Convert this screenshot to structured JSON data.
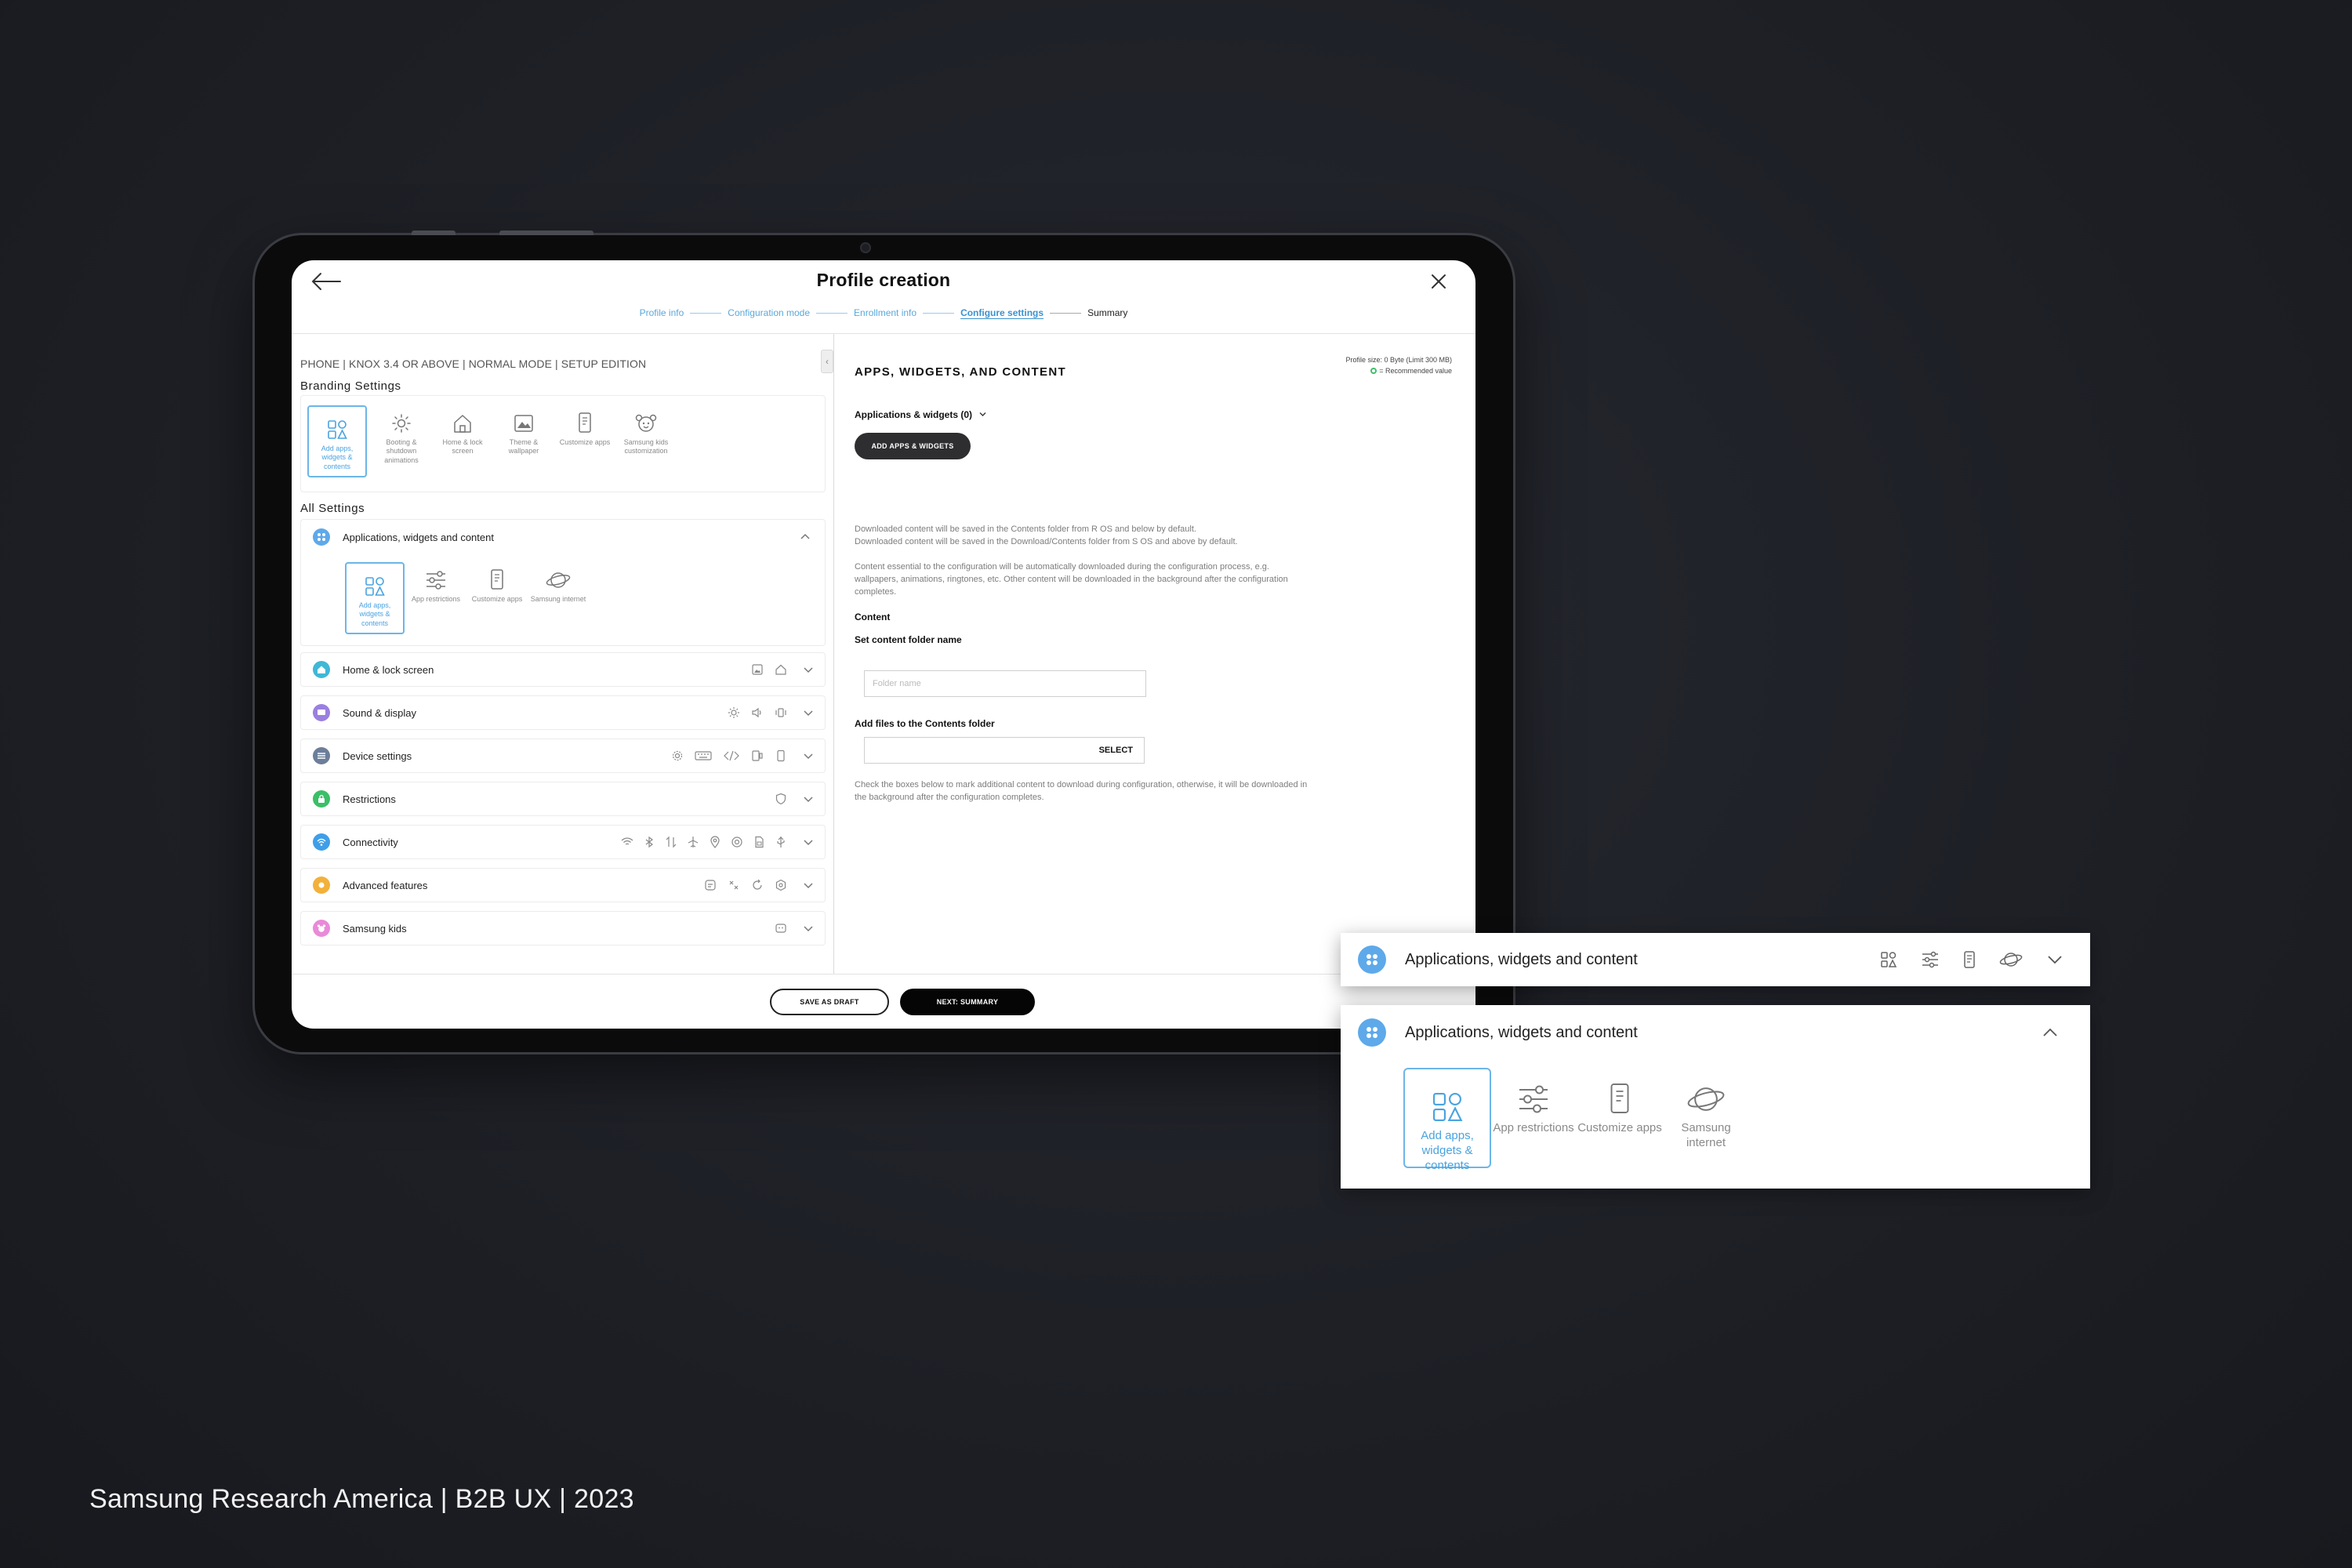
{
  "page": {
    "title": "Profile creation",
    "credit": "Samsung Research America | B2B UX | 2023"
  },
  "stepper": [
    {
      "label": "Profile info",
      "state": "done"
    },
    {
      "label": "Configuration mode",
      "state": "done"
    },
    {
      "label": "Enrollment info",
      "state": "done"
    },
    {
      "label": "Configure settings",
      "state": "active"
    },
    {
      "label": "Summary",
      "state": "todo"
    }
  ],
  "left": {
    "breadcrumb": "PHONE | KNOX 3.4 OR ABOVE | NORMAL MODE | SETUP EDITION",
    "branding_title": "Branding Settings",
    "branding_tiles": [
      {
        "label": "Add apps, widgets & contents",
        "icon": "apps-widgets-icon",
        "selected": true
      },
      {
        "label": "Booting & shutdown animations",
        "icon": "sun-icon",
        "selected": false
      },
      {
        "label": "Home & lock screen",
        "icon": "home-icon",
        "selected": false
      },
      {
        "label": "Theme & wallpaper",
        "icon": "image-icon",
        "selected": false
      },
      {
        "label": "Customize apps",
        "icon": "phone-icon",
        "selected": false
      },
      {
        "label": "Samsung kids customization",
        "icon": "kids-icon",
        "selected": false
      }
    ],
    "all_title": "All Settings",
    "expanded": {
      "label": "Applications, widgets and content",
      "tiles": [
        {
          "label": "Add apps, widgets & contents",
          "icon": "apps-widgets-icon",
          "selected": true
        },
        {
          "label": "App restrictions",
          "icon": "sliders-icon",
          "selected": false
        },
        {
          "label": "Customize apps",
          "icon": "phone-icon",
          "selected": false
        },
        {
          "label": "Samsung internet",
          "icon": "planet-icon",
          "selected": false
        }
      ]
    },
    "rows": [
      {
        "label": "Home & lock screen",
        "color": "#3fb8d6"
      },
      {
        "label": "Sound & display",
        "color": "#9b7fe0"
      },
      {
        "label": "Device settings",
        "color": "#6c7e99"
      },
      {
        "label": "Restrictions",
        "color": "#3bbf67"
      },
      {
        "label": "Connectivity",
        "color": "#3f9ee8"
      },
      {
        "label": "Advanced features",
        "color": "#f2b13a"
      },
      {
        "label": "Samsung kids",
        "color": "#e98ad8"
      }
    ]
  },
  "right": {
    "title": "APPS, WIDGETS, AND CONTENT",
    "profile_size": "Profile size: 0 Byte (Limit 300 MB)",
    "recommended": "= Recommended value",
    "apps_dropdown": "Applications & widgets (0)",
    "add_button": "ADD APPS & WIDGETS",
    "note1a": "Downloaded content will be saved in the Contents folder from R OS and below by default.",
    "note1b": "Downloaded content will be saved in the Download/Contents folder from S OS and above by default.",
    "note2": "Content essential to the configuration will be automatically downloaded during the configuration process, e.g. wallpapers, animations, ringtones, etc. Other content will be downloaded in the background after the configuration completes.",
    "content_heading": "Content",
    "folder_label": "Set content folder name",
    "folder_placeholder": "Folder name",
    "files_label": "Add files to the Contents folder",
    "select_label": "SELECT",
    "note3": "Check the boxes below to mark additional content to download during configuration, otherwise, it will be downloaded in the background after the configuration completes."
  },
  "footer": {
    "save_draft": "SAVE AS DRAFT",
    "next": "NEXT: SUMMARY"
  },
  "zoom": {
    "collapsed_label": "Applications, widgets and content",
    "expanded_label": "Applications, widgets and content",
    "tiles": [
      {
        "label": "Add apps, widgets & contents",
        "selected": true
      },
      {
        "label": "App restrictions",
        "selected": false
      },
      {
        "label": "Customize apps",
        "selected": false
      },
      {
        "label": "Samsung internet",
        "selected": false
      }
    ]
  },
  "colors": {
    "accent": "#4aa3e0",
    "apps_category": "#5ea9ea"
  }
}
